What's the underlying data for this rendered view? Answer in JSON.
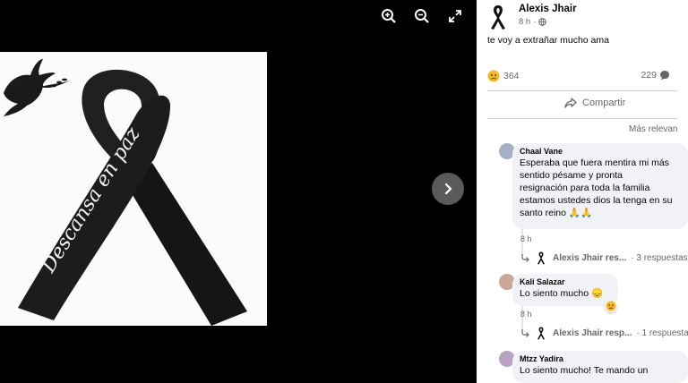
{
  "viewer": {
    "image_text": "Descansa en paz",
    "controls": [
      "zoom-in-icon",
      "zoom-out-icon",
      "fullscreen-icon"
    ],
    "next": "chevron-right-icon"
  },
  "post": {
    "author": "Alexis Jhair",
    "time": "8 h",
    "caption": "te voy a extrañar mucho ama",
    "reaction_count": "364",
    "comment_count": "229",
    "share_label": "Compartir",
    "sort_label": "Más relevan"
  },
  "comments": [
    {
      "name": "Chaal Vane",
      "lines": [
        "Esperaba que fuera mentira mi más",
        "sentido pésame y pronta",
        "resignación para toda la familia",
        "estamos ustedes dios la tenga en su",
        "santo reino 🙏🙏"
      ],
      "time": "8 h",
      "reply_author": "Alexis Jhair res...",
      "reply_count": "· 3 respuestas"
    },
    {
      "name": "Kali Salazar",
      "lines": [
        "Lo siento mucho 😞"
      ],
      "time": "8 h",
      "reply_author": "Alexis Jhair resp...",
      "reply_count": "· 1 respuesta"
    },
    {
      "name": "Mtzz Yadira",
      "lines": [
        "Lo siento mucho! Te mando un"
      ],
      "time": "",
      "reply_author": "",
      "reply_count": ""
    }
  ],
  "colors": {
    "secondary_text": "#65676b",
    "bubble": "#f0f2f5",
    "viewer_bg": "#000000"
  }
}
